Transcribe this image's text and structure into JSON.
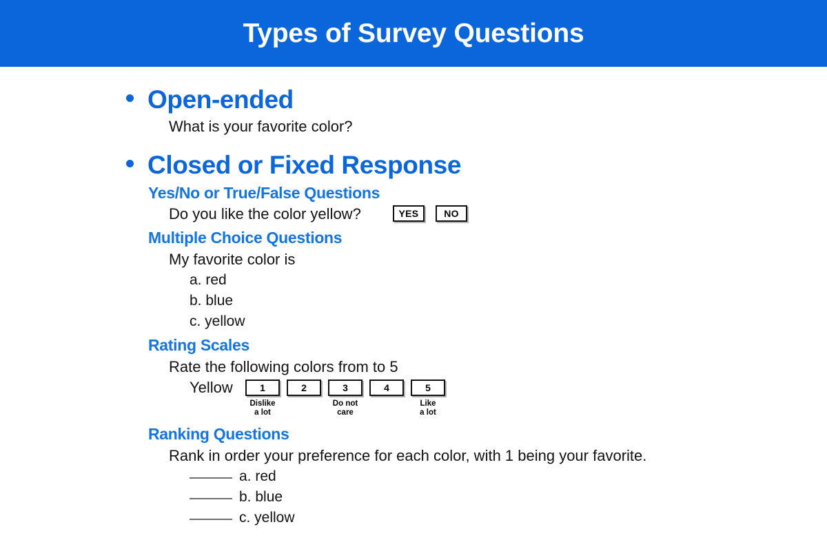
{
  "header": {
    "title": "Types of Survey Questions",
    "background_color": "#0a66da",
    "text_color": "#ffffff"
  },
  "theme": {
    "accent_blue": "#0a66da",
    "subhead_blue": "#1275e0",
    "body_text": "#111111"
  },
  "sections": [
    {
      "title": "Open-ended",
      "example": "What is your favorite color?"
    },
    {
      "title": "Closed or Fixed Response",
      "subsections": [
        {
          "heading": "Yes/No or True/False Questions",
          "prompt": "Do you like the color yellow?",
          "options": [
            "YES",
            "NO"
          ]
        },
        {
          "heading": "Multiple Choice Questions",
          "prompt": "My favorite color is",
          "choices": [
            "a. red",
            "b. blue",
            "c. yellow"
          ]
        },
        {
          "heading": "Rating Scales",
          "prompt": "Rate the following colors from to 5",
          "item_label": "Yellow",
          "scale": [
            {
              "value": "1",
              "caption": "Dislike\na lot"
            },
            {
              "value": "2",
              "caption": ""
            },
            {
              "value": "3",
              "caption": "Do not\ncare"
            },
            {
              "value": "4",
              "caption": ""
            },
            {
              "value": "5",
              "caption": "Like\na lot"
            }
          ]
        },
        {
          "heading": "Ranking Questions",
          "prompt": "Rank in order your preference for each color, with 1 being your favorite.",
          "items": [
            "a. red",
            "b. blue",
            "c. yellow"
          ]
        }
      ]
    }
  ]
}
